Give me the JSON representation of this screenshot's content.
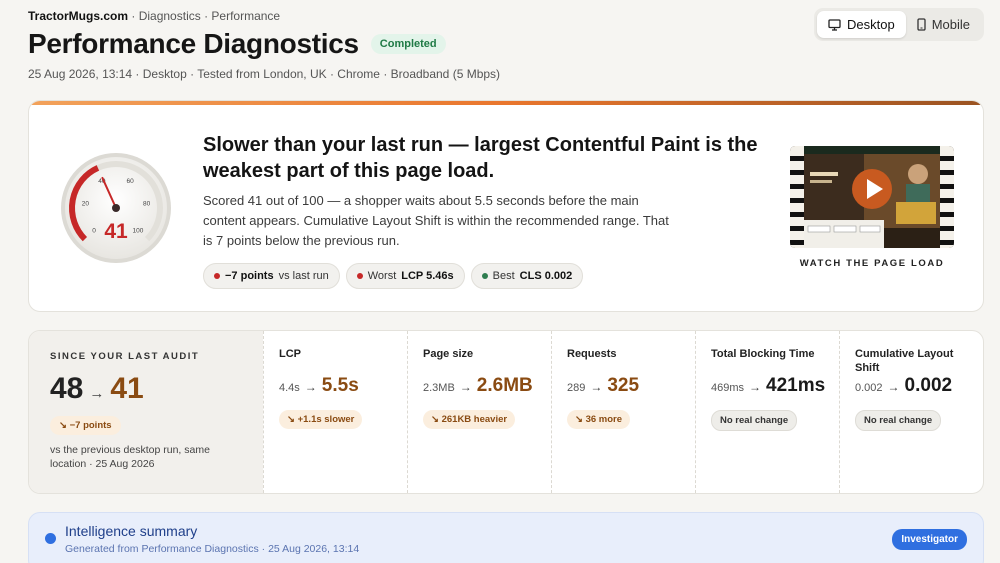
{
  "header": {
    "site": "TractorMugs.com",
    "breadcrumb_rest": "· Diagnostics · Performance",
    "title": "Performance Diagnostics",
    "status": "Completed",
    "meta": "25 Aug 2026, 13:14 · Desktop · Tested from London, UK · Chrome · Broadband (5 Mbps)"
  },
  "device_toggle": {
    "desktop_label": "Desktop",
    "mobile_label": "Mobile",
    "selected": "Desktop"
  },
  "hero": {
    "score": "41",
    "score_value": 41,
    "gauge_ticks": [
      "0",
      "20",
      "40",
      "60",
      "80",
      "100"
    ],
    "headline": "Slower than your last run — largest Contentful Paint is the weakest part of this page load.",
    "body": "Scored 41 out of 100 — a shopper waits about 5.5 seconds before the main content appears. Cumulative Layout Shift is within the recommended range. That is 7 points below the previous run.",
    "pills": {
      "change_value": "−7 points",
      "change_label": "vs last run",
      "worst_label": "Worst",
      "worst_value": "LCP 5.46s",
      "best_label": "Best",
      "best_value": "CLS 0.002"
    },
    "watch_label": "WATCH THE PAGE LOAD"
  },
  "since": {
    "label": "SINCE YOUR LAST AUDIT",
    "from": "48",
    "to": "41",
    "chip": "↘ −7 points",
    "note": "vs the previous desktop run, same location · 25 Aug 2026"
  },
  "metrics": [
    {
      "label": "LCP",
      "prev": "4.4s",
      "cur": "5.5s",
      "chip": "↘ +1.1s slower"
    },
    {
      "label": "Page size",
      "prev": "2.3MB",
      "cur": "2.6MB",
      "chip": "↘ 261KB heavier"
    },
    {
      "label": "Requests",
      "prev": "289",
      "cur": "325",
      "chip": "↘ 36 more"
    },
    {
      "label": "Total Blocking Time",
      "prev": "469ms",
      "cur": "421ms",
      "chip": "No real change"
    },
    {
      "label": "Cumulative Layout Shift",
      "prev": "0.002",
      "cur": "0.002",
      "chip": "No real change"
    }
  ],
  "intel": {
    "title": "Intelligence summary",
    "sub": "Generated from Performance Diagnostics · 25 Aug 2026, 13:14",
    "badge": "Investigator"
  },
  "colors": {
    "accent_orange": "#e9762d",
    "worse_brown": "#8a4b12",
    "status_green": "#1f7a45",
    "bad_red": "#c62828",
    "good_green": "#2e7d4f",
    "intel_blue": "#2f6fe0"
  },
  "icons": {
    "desktop": "monitor-icon",
    "mobile": "phone-icon",
    "play": "play-icon"
  }
}
